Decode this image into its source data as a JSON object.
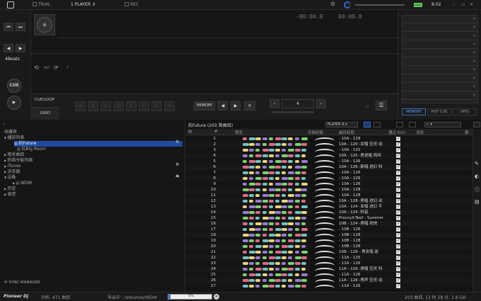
{
  "topbar": {
    "trial_label": "TRIAL",
    "player_label": "1 PLAYER",
    "rec_label": "REC",
    "time": "8:02"
  },
  "deck": {
    "beats_label": "4Beats",
    "cue_label": "CUE",
    "play_symbol": "▶",
    "time_elapsed": "-00:00.0",
    "time_remaining": "00:00.0",
    "mst_label": "MST",
    "cueloop_label": "CUE/LOOP",
    "grid_label": "GRID",
    "hotcues": [
      "A",
      "B",
      "C",
      "D",
      "E",
      "F",
      "G",
      "H"
    ],
    "memory_label": "MEMORY",
    "beat_jump_value": "4"
  },
  "right_panel": {
    "tabs": [
      "MEMORY",
      "HOT CUE",
      "INFO"
    ]
  },
  "browser": {
    "playlist_title": "抗Future",
    "playlist_count": "(203 首曲目)",
    "player_select": "PLAYER A",
    "columns": {
      "num": "#",
      "preview": "预览",
      "artwork": "专辑封面",
      "title": "曲目标题",
      "kuvo": "通过 KUV",
      "message": "消息",
      "last": "泰"
    },
    "tree": [
      {
        "label": "收藏夹",
        "indent": 0,
        "arrow": ""
      },
      {
        "label": "播放列表",
        "indent": 0,
        "arrow": "▼"
      },
      {
        "label": "抗Future",
        "indent": 3,
        "arrow": "",
        "selected": true
      },
      {
        "label": "抗Big Room",
        "indent": 3,
        "arrow": ""
      },
      {
        "label": "相关曲目",
        "indent": 0,
        "arrow": "▶"
      },
      {
        "label": "热指令能列表",
        "indent": 0,
        "arrow": "▶"
      },
      {
        "label": "iTunes",
        "indent": 0,
        "arrow": "▶"
      },
      {
        "label": "浏览器",
        "indent": 0,
        "arrow": "▶"
      },
      {
        "label": "设备",
        "indent": 0,
        "arrow": "▼"
      },
      {
        "label": "WDW",
        "indent": 2,
        "arrow": "▶"
      },
      {
        "label": "历史",
        "indent": 0,
        "arrow": "▶"
      },
      {
        "label": "录音",
        "indent": 0,
        "arrow": "▶"
      }
    ],
    "sync_manager": "SYNC MANAGER",
    "tracks": [
      {
        "num": "1",
        "title": "- 10A - 118"
      },
      {
        "num": "2",
        "title": "10A - 120 -女唱 空灵 动"
      },
      {
        "num": "3",
        "title": "- 10A - 125"
      },
      {
        "num": "4",
        "title": "10A - 125 -男说唱 鸡叫"
      },
      {
        "num": "5",
        "title": "- 10A - 126"
      },
      {
        "num": "6",
        "title": "10A - 126 -新唱 进幻 科"
      },
      {
        "num": "7",
        "title": "- 10A - 126"
      },
      {
        "num": "8",
        "title": "- 10A - 126"
      },
      {
        "num": "9",
        "title": "- 10A - 126"
      },
      {
        "num": "10",
        "title": "- 10A - 128"
      },
      {
        "num": "11",
        "title": "- 10A - 128"
      },
      {
        "num": "12",
        "title": "10A - 128 -男唱 进幻 动"
      },
      {
        "num": "13",
        "title": "10A - 124 -女唱 进幻 平"
      },
      {
        "num": "14",
        "title": "10A - 124 -科音"
      },
      {
        "num": "15",
        "title": "ProcxyX-Teef - Summer"
      },
      {
        "num": "16",
        "title": "10B - 124 -男唱 欢快"
      },
      {
        "num": "17",
        "title": "- 10B - 126"
      },
      {
        "num": "18",
        "title": "- 10B - 128"
      },
      {
        "num": "19",
        "title": "- 10B - 128"
      },
      {
        "num": "20",
        "title": "- 10B - 128"
      },
      {
        "num": "21",
        "title": "10B - 128 - 男女唱 迷"
      },
      {
        "num": "22",
        "title": "- 11A - 125"
      },
      {
        "num": "23",
        "title": "- 11A - 126"
      },
      {
        "num": "24",
        "title": "11A - 126 -男唱 空灵 科"
      },
      {
        "num": "25",
        "title": "- 11A - 126"
      },
      {
        "num": "26",
        "title": "11A - 126 -男声 空灵 动"
      },
      {
        "num": "27",
        "title": "- 11A - 126"
      }
    ]
  },
  "footer": {
    "brand": "Pioneer Dj",
    "analysis": "分析: 471 曲目",
    "export": "导出中 : /Volumes/WDW",
    "progress": 0.05,
    "progress_text": "0%",
    "summary": "203 曲目, 13 时 28 分, 1.8 GB"
  },
  "colors": {
    "accent": "#1f4ba0",
    "battery": "#3fae3f",
    "wave": [
      "#e06a8a",
      "#6fc5c0",
      "#e8d37a",
      "#9a7ad8",
      "#7bd36e"
    ]
  }
}
